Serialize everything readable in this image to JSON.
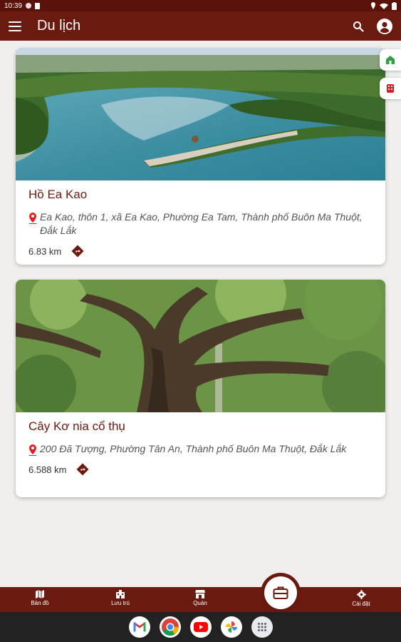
{
  "status_bar": {
    "time": "10:39"
  },
  "app_bar": {
    "title": "Du lịch"
  },
  "places": [
    {
      "name": "Hồ Ea Kao",
      "address": "Ea Kao, thôn 1, xã Ea Kao,  Phường Ea Tam, Thành phố Buôn Ma Thuột, Đắk Lắk",
      "distance": "6.83 km"
    },
    {
      "name": "Cây Kơ nia cổ thụ",
      "address": "200 Đã Tượng, Phường Tân An, Thành phố Buôn Ma Thuột, Đắk Lắk",
      "distance": "6.588 km"
    }
  ],
  "bottom_nav": {
    "items": [
      {
        "label": "Bản đồ",
        "icon": "map-icon"
      },
      {
        "label": "Lưu trú",
        "icon": "hotel-icon"
      },
      {
        "label": "Quán",
        "icon": "store-icon"
      },
      {
        "label": "Cài đặt",
        "icon": "gear-icon"
      }
    ],
    "center_icon": "briefcase-icon"
  },
  "dock": [
    "gmail-icon",
    "chrome-icon",
    "youtube-icon",
    "photos-icon",
    "apps-icon"
  ],
  "colors": {
    "primary": "#6b1a10",
    "status_bar": "#5a1208",
    "pin": "#e02020",
    "side_tab_green": "#2e9e3e",
    "side_tab_red": "#d32020"
  }
}
